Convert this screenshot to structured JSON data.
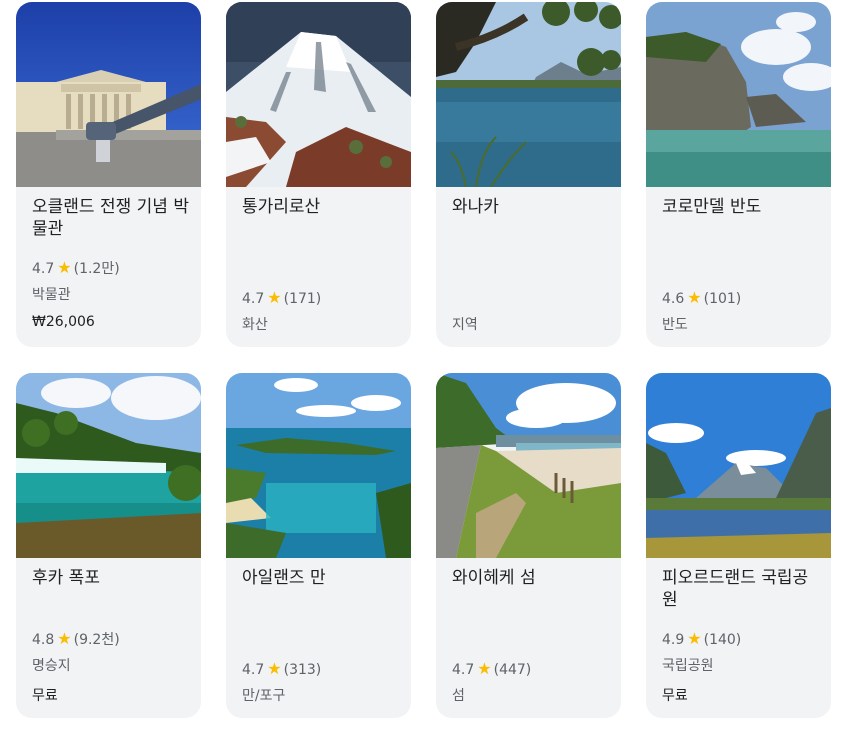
{
  "colors": {
    "card_bg": "#f1f3f4",
    "star": "#fbbc04",
    "title": "#202124",
    "muted": "#5f6368"
  },
  "places": [
    {
      "title": "오클랜드 전쟁 기념 박물관",
      "rating": "4.7",
      "reviews": "(1.2만)",
      "type": "박물관",
      "price": "₩26,006",
      "star_icon": "star-icon"
    },
    {
      "title": "통가리로산",
      "rating": "4.7",
      "reviews": "(171)",
      "type": "화산",
      "price": "",
      "star_icon": "star-icon"
    },
    {
      "title": "와나카",
      "rating": "",
      "reviews": "",
      "type": "지역",
      "price": ""
    },
    {
      "title": "코로만델 반도",
      "rating": "4.6",
      "reviews": "(101)",
      "type": "반도",
      "price": "",
      "star_icon": "star-icon"
    },
    {
      "title": "후카 폭포",
      "rating": "4.8",
      "reviews": "(9.2천)",
      "type": "명승지",
      "price": "무료",
      "star_icon": "star-icon"
    },
    {
      "title": "아일랜즈 만",
      "rating": "4.7",
      "reviews": "(313)",
      "type": "만/포구",
      "price": "",
      "star_icon": "star-icon"
    },
    {
      "title": "와이헤케 섬",
      "rating": "4.7",
      "reviews": "(447)",
      "type": "섬",
      "price": "",
      "star_icon": "star-icon"
    },
    {
      "title": "피오르드랜드 국립공원",
      "rating": "4.9",
      "reviews": "(140)",
      "type": "국립공원",
      "price": "무료",
      "star_icon": "star-icon"
    }
  ]
}
